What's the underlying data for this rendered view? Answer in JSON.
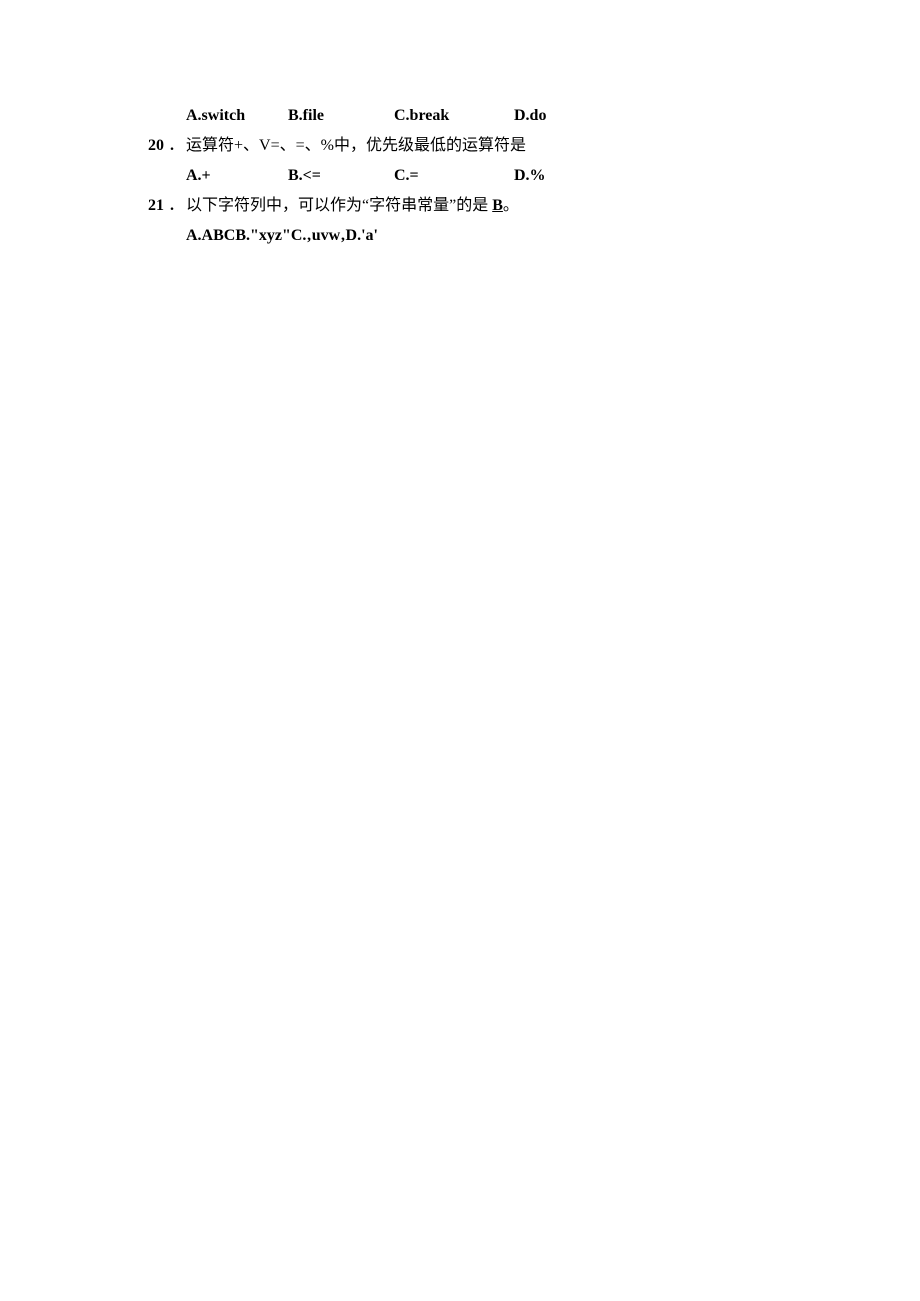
{
  "q19": {
    "optA": "A.switch",
    "optB": "B.file",
    "optC": "C.break",
    "optD": "D.do"
  },
  "q20": {
    "num": "20",
    "dot": ".",
    "text": "运算符+、V=、=、%中，优先级最低的运算符是",
    "optA": "A.+",
    "optB": "B.<=",
    "optC": "C.=",
    "optD": "D.%"
  },
  "q21": {
    "num": "21",
    "dot": ".",
    "text_pre": "以下字符列中，可以作为“字符串常量”的是 ",
    "answer": "B",
    "text_post": "。",
    "answers": "A.ABCB.\"xyz\"C.‚uvw‚D.'a'"
  }
}
